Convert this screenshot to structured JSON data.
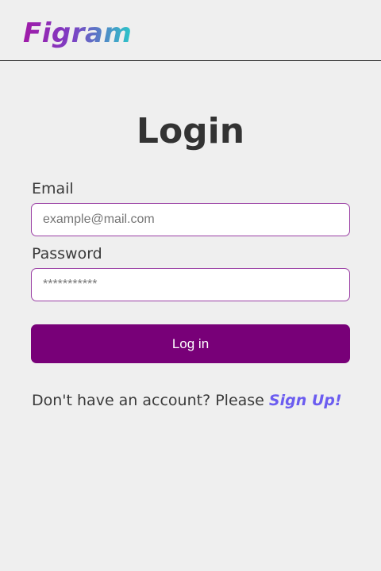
{
  "header": {
    "logo_text": "Figram"
  },
  "colors": {
    "logo_gradient_start": "#a01aa8",
    "logo_gradient_end": "#2bc7c9",
    "field_border": "#9a3fa4",
    "primary_button": "#780078",
    "link": "#6b5cf0",
    "background": "#efefef"
  },
  "login": {
    "title": "Login",
    "email_label": "Email",
    "email_placeholder": "example@mail.com",
    "email_value": "",
    "password_label": "Password",
    "password_placeholder": "***********",
    "password_value": "",
    "submit_label": "Log in",
    "signup_prompt": "Don't have an account? Please ",
    "signup_link": "Sign Up!"
  }
}
